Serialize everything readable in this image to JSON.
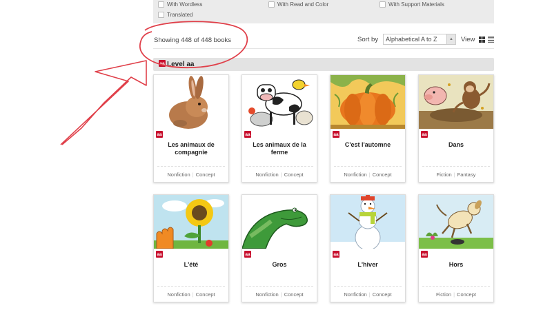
{
  "filters": [
    {
      "label": "With Wordless"
    },
    {
      "label": "With Read and Color"
    },
    {
      "label": "With Support Materials"
    },
    {
      "label": "Translated"
    }
  ],
  "results": {
    "showing": "Showing 448 of 448 books",
    "sort_label": "Sort by",
    "sort_value": "Alphabetical  A to Z",
    "view_label": "View"
  },
  "level": {
    "badge": "aa",
    "title": "Level aa"
  },
  "cards": [
    {
      "title": "Les animaux de compagnie",
      "badge": "aa",
      "genre": "Nonfiction",
      "subgenre": "Concept",
      "cover": "rabbit"
    },
    {
      "title": "Les animaux de la ferme",
      "badge": "aa",
      "genre": "Nonfiction",
      "subgenre": "Concept",
      "cover": "farm-animals"
    },
    {
      "title": "C'est l'automne",
      "badge": "aa",
      "genre": "Nonfiction",
      "subgenre": "Concept",
      "cover": "pumpkin"
    },
    {
      "title": "Dans",
      "badge": "aa",
      "genre": "Fiction",
      "subgenre": "Fantasy",
      "cover": "pig-and-monkey"
    },
    {
      "title": "L'été",
      "badge": "aa",
      "genre": "Nonfiction",
      "subgenre": "Concept",
      "cover": "sunflower"
    },
    {
      "title": "Gros",
      "badge": "aa",
      "genre": "Nonfiction",
      "subgenre": "Concept",
      "cover": "dinosaur"
    },
    {
      "title": "L'hiver",
      "badge": "aa",
      "genre": "Nonfiction",
      "subgenre": "Concept",
      "cover": "snowman"
    },
    {
      "title": "Hors",
      "badge": "aa",
      "genre": "Fiction",
      "subgenre": "Concept",
      "cover": "jumping-dog"
    }
  ],
  "colors": {
    "accent": "#c8102e",
    "annotation": "#e0404a",
    "panel": "#ebebeb"
  }
}
